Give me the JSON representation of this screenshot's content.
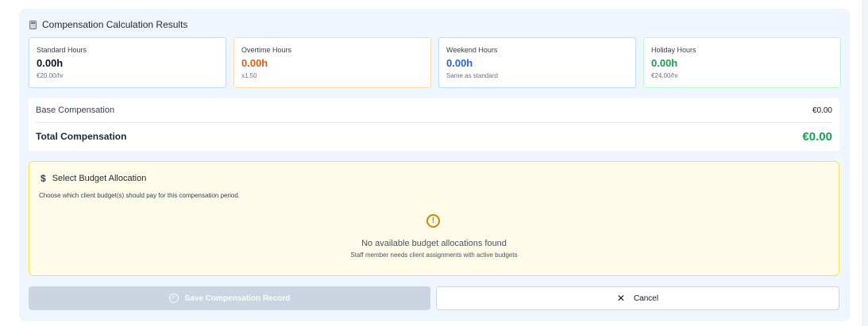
{
  "panel": {
    "title": "Compensation Calculation Results",
    "icon": "calculator-icon"
  },
  "cards": {
    "standard": {
      "label": "Standard Hours",
      "value": "0.00h",
      "sub": "€20.00/hr",
      "color": "#111827"
    },
    "overtime": {
      "label": "Overtime Hours",
      "value": "0.00h",
      "sub": "x1.50",
      "color": "#ea580c"
    },
    "weekend": {
      "label": "Weekend Hours",
      "value": "0.00h",
      "sub": "Same as standard",
      "color": "#2563eb"
    },
    "holiday": {
      "label": "Holiday Hours",
      "value": "0.00h",
      "sub": "€24.00/hr",
      "color": "#16a34a"
    }
  },
  "summary": {
    "base_label": "Base Compensation",
    "base_value": "€0.00",
    "total_label": "Total Compensation",
    "total_value": "€0.00"
  },
  "budget": {
    "icon": "dollar-icon",
    "title": "Select Budget Allocation",
    "description": "Choose which client budget(s) should pay for this compensation period.",
    "empty_title": "No available budget allocations found",
    "empty_subtitle": "Staff member needs client assignments with active budgets",
    "warning_icon": "alert-circle-icon"
  },
  "actions": {
    "save_label": "Save Compensation Record",
    "save_disabled": true,
    "cancel_label": "Cancel"
  }
}
